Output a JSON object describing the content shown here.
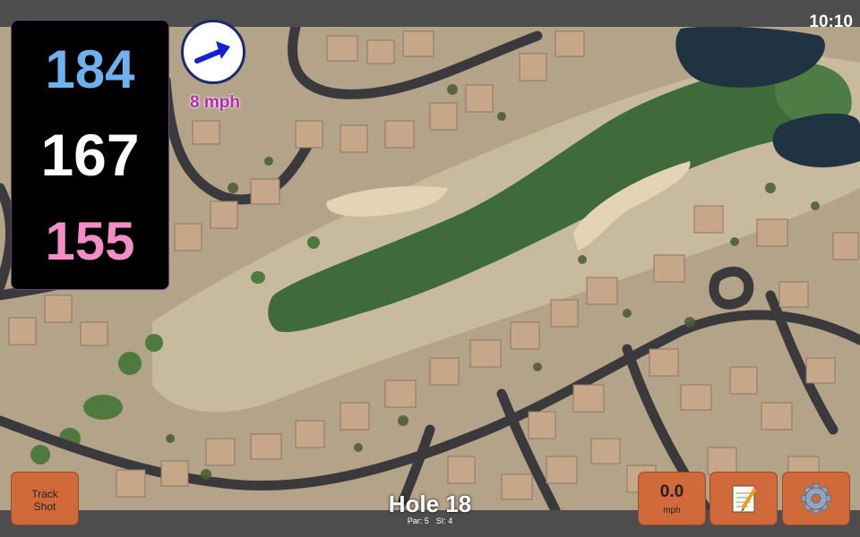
{
  "clock": "10:10",
  "yardages": {
    "back": "184",
    "middle": "167",
    "front": "155"
  },
  "wind": {
    "speed_label": "8 mph",
    "icon": "wind-arrow-icon"
  },
  "hole": {
    "title": "Hole 18",
    "par_label": "Par: 5",
    "si_label": "SI: 4"
  },
  "buttons": {
    "track_shot_line1": "Track",
    "track_shot_line2": "Shot",
    "speed_value": "0.0",
    "speed_unit": "mph",
    "notes_icon": "notepad-icon",
    "settings_icon": "gear-icon"
  },
  "colors": {
    "back": "#6fb0ee",
    "middle": "#ffffff",
    "front": "#f28dc6",
    "wind_label": "#b22bb0",
    "button": "#d06a3a"
  }
}
